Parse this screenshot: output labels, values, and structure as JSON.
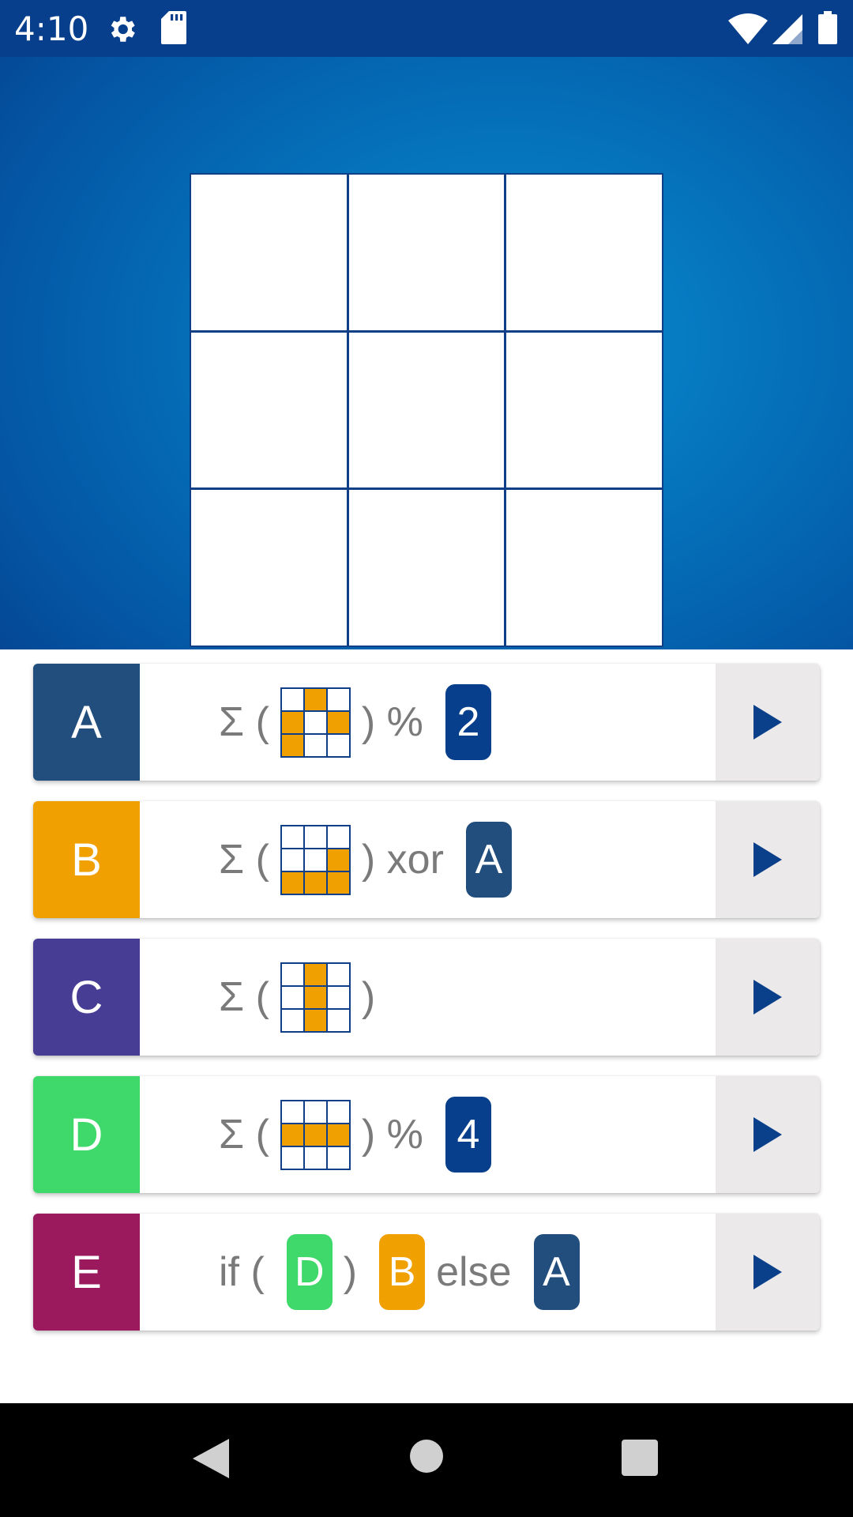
{
  "status_bar": {
    "time": "4:10",
    "icons": [
      "settings-gear-icon",
      "sd-card-icon",
      "wifi-icon",
      "cell-signal-icon",
      "battery-icon"
    ]
  },
  "board": {
    "rows": 3,
    "cols": 3,
    "cell_color": "#ffffff",
    "line_color": "#0e3f87"
  },
  "rules": [
    {
      "key": "A",
      "color": "#214e7d",
      "tokens": [
        {
          "type": "text",
          "value": "Σ ("
        },
        {
          "type": "grid",
          "cells": [
            0,
            1,
            0,
            1,
            0,
            1,
            1,
            0,
            0
          ]
        },
        {
          "type": "text",
          "value": ") %"
        },
        {
          "type": "chip",
          "value": "2",
          "color": "#083f8c"
        }
      ]
    },
    {
      "key": "B",
      "color": "#f0a000",
      "tokens": [
        {
          "type": "text",
          "value": "Σ ("
        },
        {
          "type": "grid",
          "cells": [
            0,
            0,
            0,
            0,
            0,
            1,
            1,
            1,
            1
          ]
        },
        {
          "type": "text",
          "value": ") xor"
        },
        {
          "type": "chip",
          "value": "A",
          "color": "#214e7d"
        }
      ]
    },
    {
      "key": "C",
      "color": "#483d94",
      "tokens": [
        {
          "type": "text",
          "value": "Σ ("
        },
        {
          "type": "grid",
          "cells": [
            0,
            1,
            0,
            0,
            1,
            0,
            0,
            1,
            0
          ]
        },
        {
          "type": "text",
          "value": ")"
        }
      ]
    },
    {
      "key": "D",
      "color": "#3fd86a",
      "tokens": [
        {
          "type": "text",
          "value": "Σ ("
        },
        {
          "type": "grid",
          "cells": [
            0,
            0,
            0,
            1,
            1,
            1,
            0,
            0,
            0
          ]
        },
        {
          "type": "text",
          "value": ") %"
        },
        {
          "type": "chip",
          "value": "4",
          "color": "#083f8c"
        }
      ]
    },
    {
      "key": "E",
      "color": "#9b1a5e",
      "tokens": [
        {
          "type": "text",
          "value": "if ("
        },
        {
          "type": "chip",
          "value": "D",
          "color": "#3fd86a"
        },
        {
          "type": "text",
          "value": ")"
        },
        {
          "type": "chip",
          "value": "B",
          "color": "#f0a000"
        },
        {
          "type": "text",
          "value": "else"
        },
        {
          "type": "chip",
          "value": "A",
          "color": "#214e7d"
        }
      ]
    }
  ],
  "run_button_icon": "play-arrow-icon",
  "nav_bar": {
    "icons": [
      "back-icon",
      "home-icon",
      "recents-icon"
    ]
  }
}
